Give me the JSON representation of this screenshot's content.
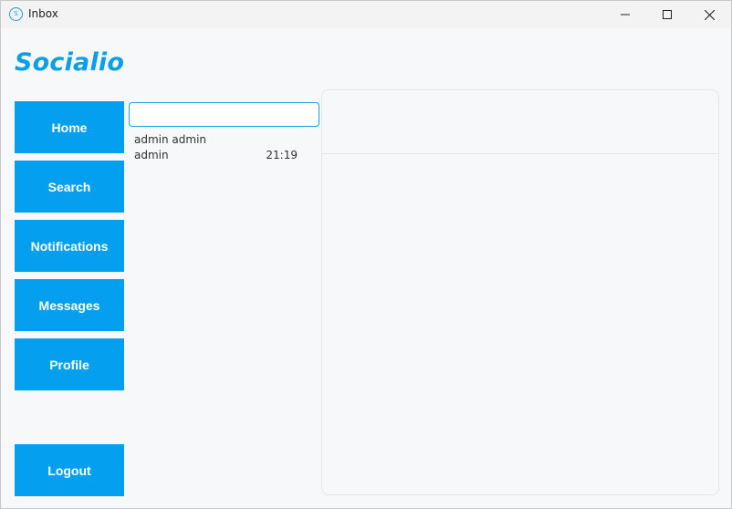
{
  "window": {
    "title": "Inbox",
    "app_icon_glyph": "S"
  },
  "brand": {
    "name": "Socialio",
    "color": "#0a9fe8"
  },
  "nav": {
    "accent": "#059ff0",
    "items": [
      {
        "label": "Home"
      },
      {
        "label": "Search"
      },
      {
        "label": "Notifications"
      },
      {
        "label": "Messages"
      },
      {
        "label": "Profile"
      }
    ],
    "logout_label": "Logout"
  },
  "inbox": {
    "search": {
      "value": "",
      "placeholder": ""
    },
    "conversations": [
      {
        "name": "admin admin",
        "last_message": "admin",
        "time": "21:19"
      }
    ]
  }
}
